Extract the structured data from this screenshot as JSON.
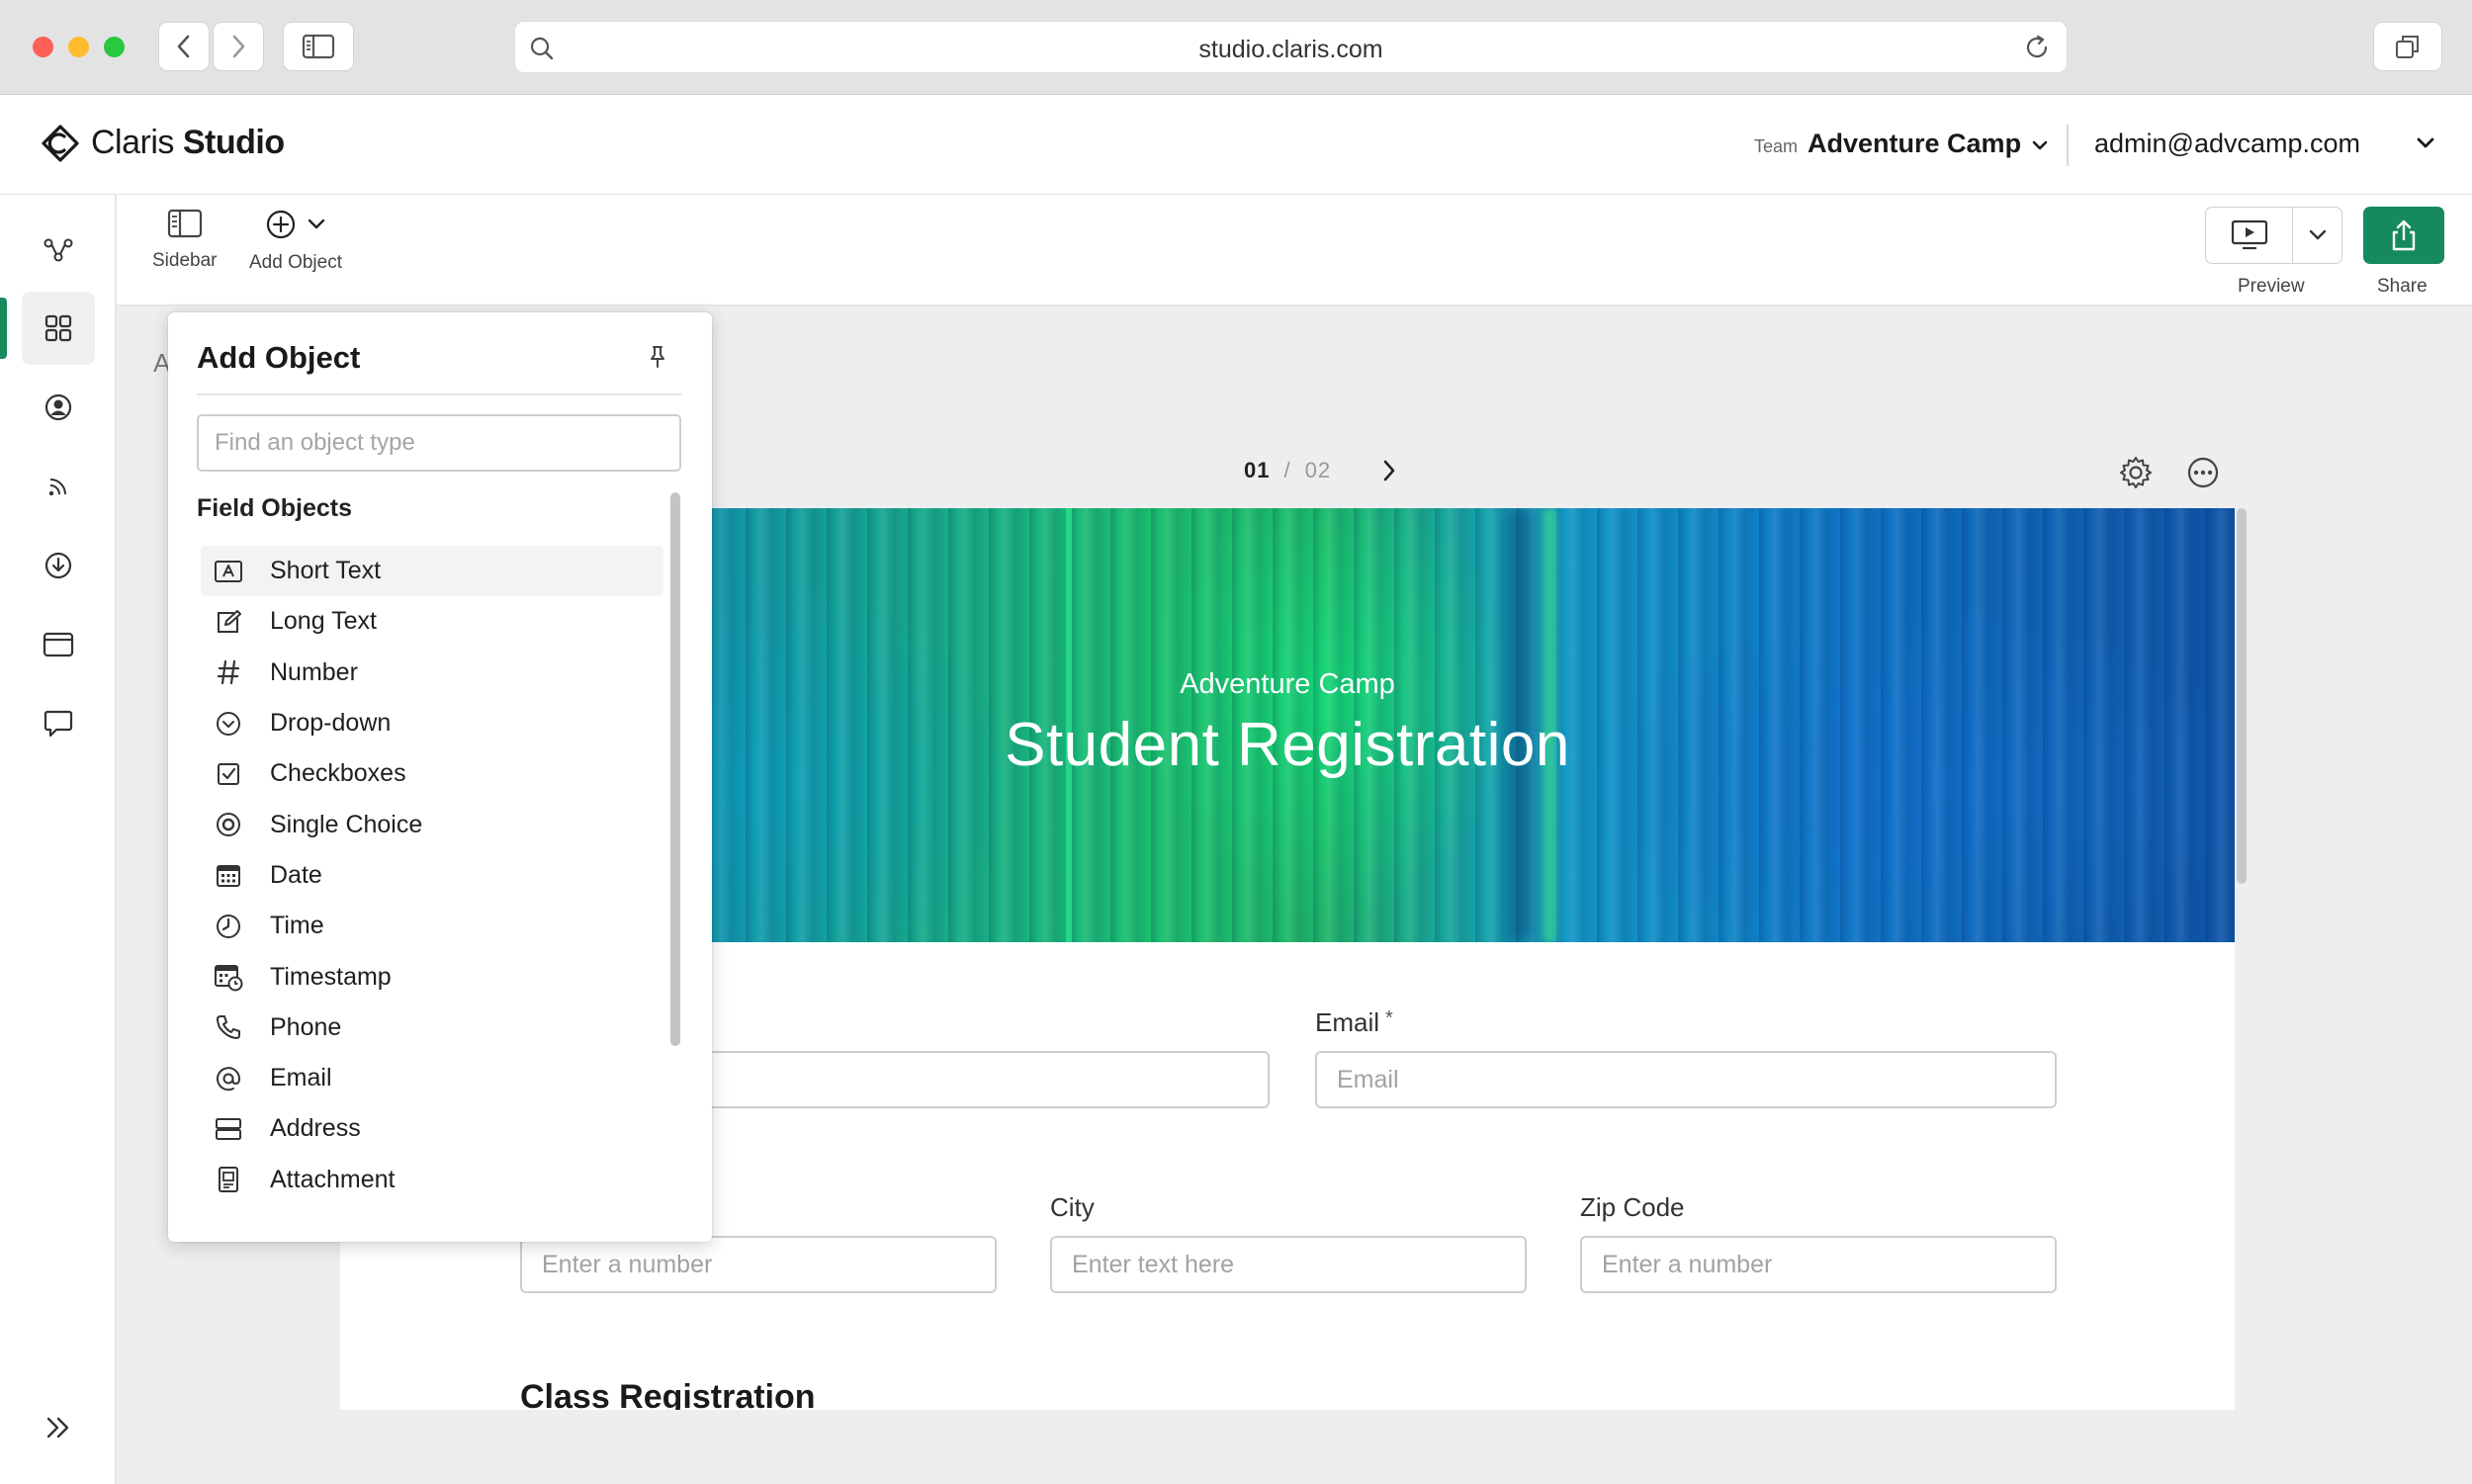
{
  "browser": {
    "url": "studio.claris.com"
  },
  "app": {
    "logo_name": "Claris",
    "logo_product": "Studio"
  },
  "header": {
    "team_label": "Team",
    "team_name": "Adventure Camp",
    "user_email": "admin@advcamp.com"
  },
  "toolbar": {
    "sidebar_label": "Sidebar",
    "add_object_label": "Add Object",
    "preview_label": "Preview",
    "share_label": "Share"
  },
  "rail": {
    "items": [
      "flow-icon",
      "layouts-icon",
      "users-icon",
      "feeds-icon",
      "import-icon",
      "window-icon",
      "chat-icon"
    ],
    "expand": "expand-icon"
  },
  "panel": {
    "title": "Add Object",
    "search_placeholder": "Find an object type",
    "group_title": "Field Objects",
    "items": [
      {
        "label": "Short Text",
        "icon": "short-text-icon"
      },
      {
        "label": "Long Text",
        "icon": "long-text-icon"
      },
      {
        "label": "Number",
        "icon": "number-icon"
      },
      {
        "label": "Drop-down",
        "icon": "dropdown-icon"
      },
      {
        "label": "Checkboxes",
        "icon": "checkbox-icon"
      },
      {
        "label": "Single Choice",
        "icon": "radio-icon"
      },
      {
        "label": "Date",
        "icon": "calendar-icon"
      },
      {
        "label": "Time",
        "icon": "clock-icon"
      },
      {
        "label": "Timestamp",
        "icon": "timestamp-icon"
      },
      {
        "label": "Phone",
        "icon": "phone-icon"
      },
      {
        "label": "Email",
        "icon": "at-icon"
      },
      {
        "label": "Address",
        "icon": "address-icon"
      },
      {
        "label": "Attachment",
        "icon": "attachment-icon"
      }
    ]
  },
  "canvas": {
    "stub_text": "A",
    "pager": {
      "current": "01",
      "separator": "/",
      "total": "02"
    },
    "banner": {
      "subtitle": "Adventure Camp",
      "title": "Student Registration"
    },
    "fields": {
      "email_label": "Email",
      "email_required": "*",
      "email_placeholder": "Email",
      "number_placeholder": "Enter a number",
      "city_label": "City",
      "city_placeholder": "Enter text here",
      "zip_label": "Zip Code",
      "zip_placeholder": "Enter a number"
    },
    "section_title": "Class Registration"
  },
  "colors": {
    "accent": "#168a5c",
    "banner_green": "#1cc06f",
    "banner_blue": "#0f74c5"
  }
}
